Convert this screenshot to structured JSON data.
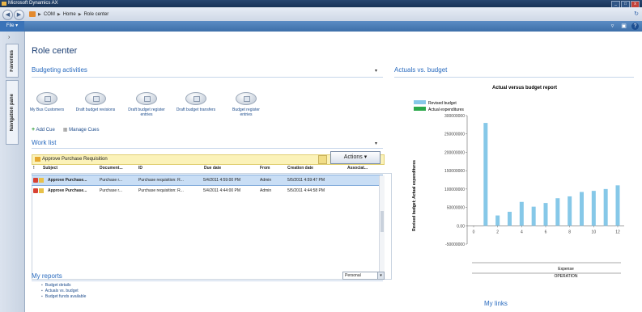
{
  "window": {
    "title": "Microsoft Dynamics AX",
    "buttons": [
      "_",
      "□",
      "x"
    ]
  },
  "address": {
    "crumbs": [
      "COM",
      "Home",
      "Role center"
    ]
  },
  "file_tab": "File",
  "left_tabs": [
    "Favorites",
    "Navigation pane"
  ],
  "page_title": "Role center",
  "budgeting": {
    "header": "Budgeting activities",
    "tiles": [
      "My Bus Customers",
      "Draft budget revisions",
      "Draft budget register entries",
      "Draft budget transfers",
      "Budget register entries"
    ],
    "add_cue": "Add Cue",
    "manage_cues": "Manage Cues"
  },
  "worklist": {
    "header": "Work list",
    "filter": "Approve Purchase Requisition",
    "actions_label": "Actions",
    "columns": [
      "!",
      "Subject",
      "Document...",
      "ID",
      "Due date",
      "From",
      "Creation date",
      "Associat..."
    ],
    "rows": [
      [
        "Approve Purchase...",
        "Purchase r...",
        "Purchase requisition: R...",
        "5/4/2011 4:59:00 PM",
        "Admin",
        "5/5/2011 4:59:47 PM"
      ],
      [
        "Approve Purchase...",
        "Purchase r...",
        "Purchase requisition: R...",
        "5/4/2011 4:44:00 PM",
        "Admin",
        "5/5/2011 4:44:58 PM"
      ]
    ]
  },
  "reports": {
    "header": "My reports",
    "items": [
      "Budget details",
      "Actuals vs. budget",
      "Budget funds available"
    ],
    "dropdown": "Personal"
  },
  "actuals": {
    "header": "Actuals vs. budget"
  },
  "links_header": "My links",
  "chart_data": {
    "type": "bar",
    "title": "Actual versus budget report",
    "ylabel": "Revised budget; Actual expenditures",
    "legend": [
      "Revised budget",
      "Actual expenditures"
    ],
    "legend_placement": "top-left",
    "x": [
      1,
      2,
      3,
      4,
      5,
      6,
      7,
      8,
      9,
      10,
      11,
      12
    ],
    "x_ticks": [
      "0",
      "2",
      "4",
      "6",
      "8",
      "10",
      "12"
    ],
    "y_ticks": [
      "300000000",
      "250000000",
      "200000000",
      "150000000",
      "100000000",
      "50000000",
      "0.00",
      "-50000000"
    ],
    "ylim": [
      -50000000,
      300000000
    ],
    "series": [
      {
        "name": "Revised budget",
        "values": [
          280000000,
          28000000,
          38000000,
          65000000,
          52000000,
          62000000,
          75000000,
          80000000,
          92000000,
          95000000,
          100000000,
          110000000
        ]
      },
      {
        "name": "Actual expenditures",
        "values": [
          0,
          0,
          0,
          0,
          0,
          0,
          0,
          0,
          0,
          0,
          0,
          0
        ]
      }
    ],
    "x_group_labels": [
      "Expense",
      "OPERATION"
    ],
    "colors": {
      "Revised budget": "#86c8e8",
      "Actual expenditures": "#2ba84a"
    }
  }
}
